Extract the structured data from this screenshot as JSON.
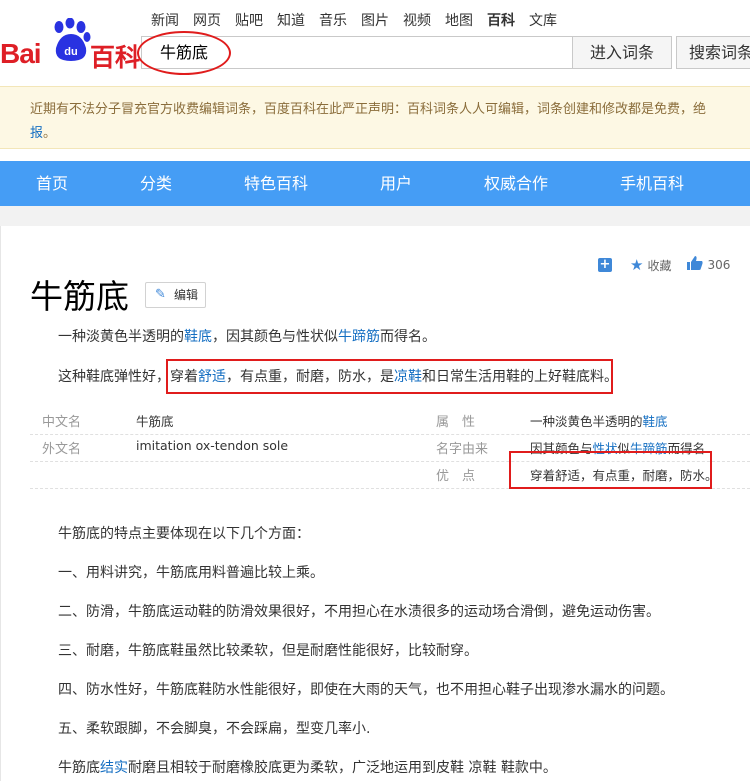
{
  "topnav": [
    "新闻",
    "网页",
    "贴吧",
    "知道",
    "音乐",
    "图片",
    "视频",
    "地图",
    "百科",
    "文库"
  ],
  "topnav_active": "百科",
  "logo": {
    "bai": "Bai",
    "du": "du",
    "baike": "百科"
  },
  "search": {
    "value": "牛筋底",
    "enter_label": "进入词条",
    "search_label": "搜索词条"
  },
  "notice": {
    "line1": "近期有不法分子冒充官方收费编辑词条，百度百科在此严正声明：百科词条人人可编辑，词条创建和修改都是免费，绝",
    "line2_link": "报",
    "line2_rest": "。"
  },
  "bluenav": [
    "首页",
    "分类",
    "特色百科",
    "用户",
    "权威合作",
    "手机百科"
  ],
  "tools": {
    "collect": "收藏",
    "likes": "306"
  },
  "entry": {
    "title": "牛筋底",
    "edit_label": "编辑",
    "summary1": {
      "a": "一种淡黄色半透明的",
      "link1": "鞋底",
      "b": "，因其颜色与性状似",
      "link2": "牛蹄筋",
      "c": "而得名。"
    },
    "summary2": {
      "a": "这种鞋底弹性好，",
      "b": "穿着",
      "link1": "舒适",
      "c": "，有点重，耐磨，防水，是",
      "link2": "凉鞋",
      "d": "和日常生活用鞋的上好鞋底料。"
    }
  },
  "basic_info": {
    "left": [
      {
        "key": "中文名",
        "value": "牛筋底"
      },
      {
        "key": "外文名",
        "value": "imitation ox-tendon sole"
      }
    ],
    "right": [
      {
        "key": "属　性",
        "value_a": "一种淡黄色半透明的",
        "value_link": "鞋底"
      },
      {
        "key": "名字由来",
        "value_a": "因其颜色与",
        "value_link": "性状",
        "value_b": "似",
        "value_link2": "牛蹄筋",
        "value_c": "而得名"
      },
      {
        "key": "优　点",
        "value_a": "穿着舒适，有点重，耐磨，防水。"
      }
    ]
  },
  "body": {
    "intro": "牛筋底的特点主要体现在以下几个方面：",
    "items": [
      "一、用料讲究，牛筋底用料普遍比较上乘。",
      "二、防滑，牛筋底运动鞋的防滑效果很好，不用担心在水渍很多的运动场合滑倒，避免运动伤害。",
      "三、耐磨，牛筋底鞋虽然比较柔软，但是耐磨性能很好，比较耐穿。",
      "四、防水性好，牛筋底鞋防水性能很好，即使在大雨的天气，也不用担心鞋子出现渗水漏水的问题。",
      "五、柔软跟脚，不会脚臭，不会踩扁，型变几率小."
    ],
    "last": {
      "a": "牛筋底",
      "link": "结实",
      "b": "耐磨且相较于耐磨橡胶底更为柔软，广泛地运用到皮鞋 凉鞋 鞋款中。"
    }
  }
}
